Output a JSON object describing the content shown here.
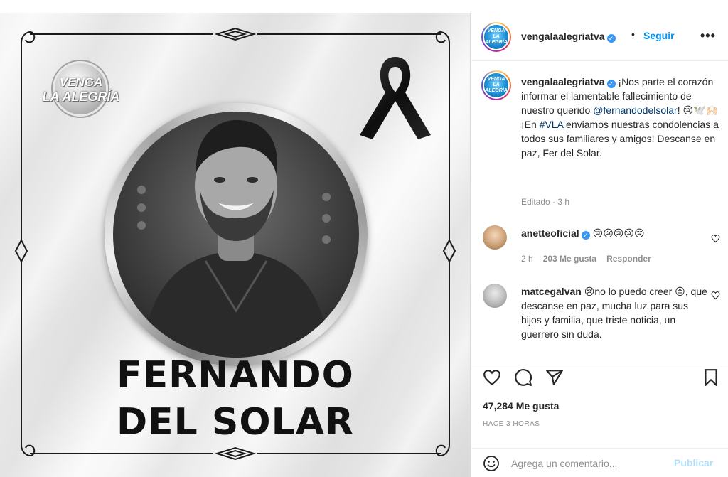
{
  "post_image": {
    "logo_line1": "VENGA",
    "logo_line2": "LA ALEGRÍA",
    "name_line1": "FERNANDO",
    "name_line2": "DEL SOLAR"
  },
  "header": {
    "username": "vengalaalegriatva",
    "follow_label": "Seguir",
    "more_label": "•••"
  },
  "caption": {
    "username": "vengalaalegriatva",
    "text_part1": "¡Nos parte el corazón informar el lamentable fallecimiento de nuestro querido ",
    "mention": "@fernandodelsolar",
    "text_part2": "! 😢🕊️🙌🏻",
    "text_part3": "¡En ",
    "hashtag": "#VLA",
    "text_part4": " enviamos nuestras condolencias a todos sus familiares y amigos! Descanse en paz, Fer del Solar.",
    "edited": "Editado · 3 h"
  },
  "comments": [
    {
      "username": "anetteoficial",
      "text": "😢😢😢😢😢",
      "time": "2 h",
      "likes": "203 Me gusta",
      "reply_label": "Responder"
    },
    {
      "username": "matcegalvan",
      "text": "😢no lo puedo creer 😔, que descanse en paz, mucha luz para sus hijos y familia, que triste noticia, un guerrero sin duda."
    }
  ],
  "actions": {
    "likes": "47,284 Me gusta",
    "time_ago": "HACE 3 HORAS",
    "comment_placeholder": "Agrega un comentario...",
    "publish_label": "Publicar"
  },
  "colors": {
    "link": "#00376b",
    "follow": "#0095f6",
    "publish_disabled": "#b2dffc",
    "verified": "#3897f0"
  }
}
